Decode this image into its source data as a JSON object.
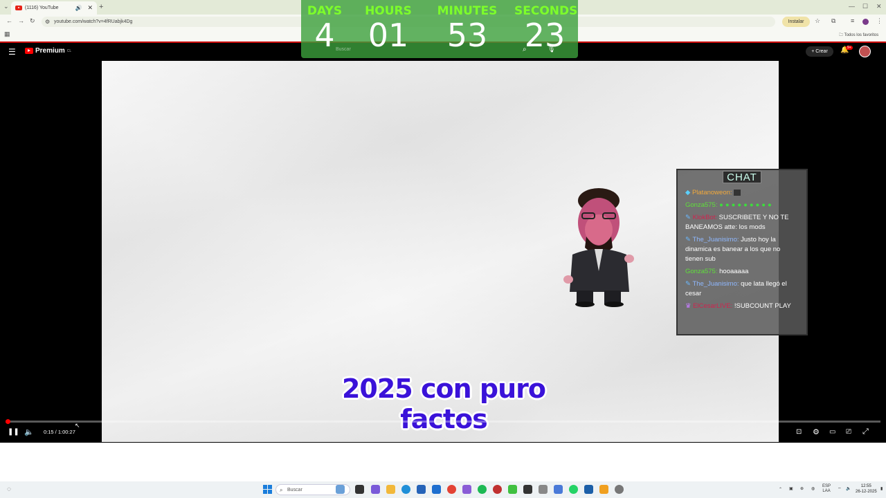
{
  "browser": {
    "tab_title": "(1116) YouTube",
    "url": "youtube.com/watch?v=4fRUabjk4Dg",
    "install_label": "Instalar",
    "bookmarks_label": "Todos los favoritos"
  },
  "youtube": {
    "logo_text": "Premium",
    "logo_superscript": "CL",
    "search_placeholder": "Buscar",
    "create_label": "Crear",
    "notification_badge": "9+"
  },
  "countdown": [
    {
      "label": "DAYS",
      "value": "4"
    },
    {
      "label": "HOURS",
      "value": "01"
    },
    {
      "label": "MINUTES",
      "value": "53"
    },
    {
      "label": "SECONDS",
      "value": "23"
    }
  ],
  "chat": {
    "title": "CHAT",
    "messages": [
      {
        "user": "Platanoweon:",
        "text": "",
        "user_color": "#f2a93b"
      },
      {
        "user": "Gonza575:",
        "text": "",
        "user_color": "#5fe03a"
      },
      {
        "user": "KlokBot:",
        "text": "SUSCRIBETE Y NO TE BANEAMOS atte: los mods",
        "user_color": "#d0234e"
      },
      {
        "user": "The_Juanisimo:",
        "text": "Justo hoy la dinamica es banear a los que no tienen sub",
        "user_color": "#8fb8ff"
      },
      {
        "user": "Gonza575:",
        "text": "hooaaaaa",
        "user_color": "#5fe03a"
      },
      {
        "user": "The_Juanisimo:",
        "text": "que lata llegó el cesar",
        "user_color": "#8fb8ff"
      },
      {
        "user": "ElCesarLIVE:",
        "text": "!SUBCOUNT PLAY",
        "user_color": "#d0234e"
      }
    ]
  },
  "caption": "2025 con puro factos",
  "player": {
    "time_display": "0:15 / 1:00:27",
    "progress": 0.004
  },
  "taskbar": {
    "search_placeholder": "Buscar",
    "lang_line1": "ESP",
    "lang_line2": "LAA",
    "time": "12:55",
    "date": "26-12-2025"
  }
}
